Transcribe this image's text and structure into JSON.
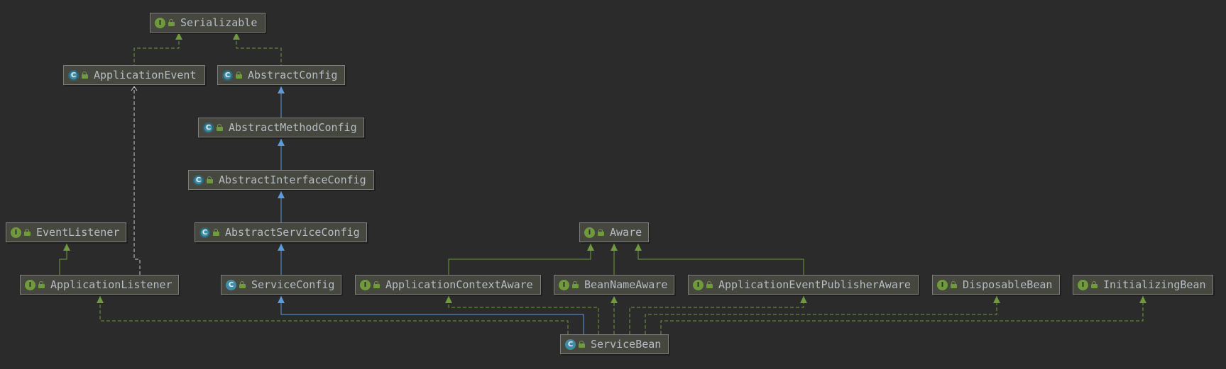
{
  "diagram": {
    "title": "",
    "nodes": {
      "serializable": {
        "label": "Serializable",
        "kind": "interface",
        "badge": "I"
      },
      "application_event": {
        "label": "ApplicationEvent",
        "kind": "abstract",
        "badge": "C"
      },
      "abstract_config": {
        "label": "AbstractConfig",
        "kind": "abstract",
        "badge": "C"
      },
      "abstract_method_config": {
        "label": "AbstractMethodConfig",
        "kind": "abstract",
        "badge": "C"
      },
      "abstract_interface_config": {
        "label": "AbstractInterfaceConfig",
        "kind": "abstract",
        "badge": "C"
      },
      "abstract_service_config": {
        "label": "AbstractServiceConfig",
        "kind": "abstract",
        "badge": "C"
      },
      "event_listener": {
        "label": "EventListener",
        "kind": "interface",
        "badge": "I"
      },
      "application_listener": {
        "label": "ApplicationListener",
        "kind": "interface",
        "badge": "I"
      },
      "service_config": {
        "label": "ServiceConfig",
        "kind": "class",
        "badge": "C"
      },
      "aware": {
        "label": "Aware",
        "kind": "interface",
        "badge": "I"
      },
      "application_context_aware": {
        "label": "ApplicationContextAware",
        "kind": "interface",
        "badge": "I"
      },
      "bean_name_aware": {
        "label": "BeanNameAware",
        "kind": "interface",
        "badge": "I"
      },
      "application_event_publisher_aware": {
        "label": "ApplicationEventPublisherAware",
        "kind": "interface",
        "badge": "I"
      },
      "disposable_bean": {
        "label": "DisposableBean",
        "kind": "interface",
        "badge": "I"
      },
      "initializing_bean": {
        "label": "InitializingBean",
        "kind": "interface",
        "badge": "I"
      },
      "service_bean": {
        "label": "ServiceBean",
        "kind": "class",
        "badge": "C"
      }
    },
    "edges": [
      {
        "from": "application_event",
        "to": "serializable",
        "type": "implements"
      },
      {
        "from": "abstract_config",
        "to": "serializable",
        "type": "implements"
      },
      {
        "from": "abstract_method_config",
        "to": "abstract_config",
        "type": "extends"
      },
      {
        "from": "abstract_interface_config",
        "to": "abstract_method_config",
        "type": "extends"
      },
      {
        "from": "abstract_service_config",
        "to": "abstract_interface_config",
        "type": "extends"
      },
      {
        "from": "service_config",
        "to": "abstract_service_config",
        "type": "extends"
      },
      {
        "from": "application_listener",
        "to": "event_listener",
        "type": "extends"
      },
      {
        "from": "application_listener",
        "to": "application_event",
        "type": "uses"
      },
      {
        "from": "application_context_aware",
        "to": "aware",
        "type": "extends"
      },
      {
        "from": "bean_name_aware",
        "to": "aware",
        "type": "extends"
      },
      {
        "from": "application_event_publisher_aware",
        "to": "aware",
        "type": "extends"
      },
      {
        "from": "service_bean",
        "to": "service_config",
        "type": "extends"
      },
      {
        "from": "service_bean",
        "to": "application_listener",
        "type": "implements"
      },
      {
        "from": "service_bean",
        "to": "application_context_aware",
        "type": "implements"
      },
      {
        "from": "service_bean",
        "to": "bean_name_aware",
        "type": "implements"
      },
      {
        "from": "service_bean",
        "to": "application_event_publisher_aware",
        "type": "implements"
      },
      {
        "from": "service_bean",
        "to": "disposable_bean",
        "type": "implements"
      },
      {
        "from": "service_bean",
        "to": "initializing_bean",
        "type": "implements"
      }
    ],
    "colors": {
      "background": "#2b2b2b",
      "extends_class": "#5b9be0",
      "extends_interface": "#6f9b3a",
      "implements": "#6f9b3a",
      "uses": "#c8c8c8"
    }
  },
  "footer": {
    "text": ""
  }
}
